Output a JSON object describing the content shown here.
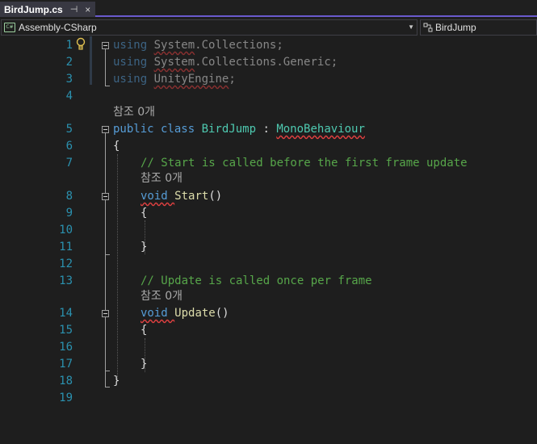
{
  "tab": {
    "title": "BirdJump.cs",
    "pin_glyph": "⊣",
    "close_glyph": "×"
  },
  "navbar": {
    "project": "Assembly-CSharp",
    "type": "BirdJump",
    "cs_badge": "C#"
  },
  "code_lens": {
    "refs": "참조 0개"
  },
  "lines": [
    {
      "n": "1",
      "text": "using System.Collections;"
    },
    {
      "n": "2",
      "text": "using System.Collections.Generic;"
    },
    {
      "n": "3",
      "text": "using UnityEngine;"
    },
    {
      "n": "4",
      "text": ""
    },
    {
      "n": "5",
      "kw": "public class ",
      "name": "BirdJump",
      "sep": " : ",
      "base": "MonoBehaviour"
    },
    {
      "n": "6",
      "text": "{"
    },
    {
      "n": "7",
      "comment": "// Start is called before the first frame update"
    },
    {
      "n": "8",
      "kw": "void ",
      "name": "Start",
      "tail": "()"
    },
    {
      "n": "9",
      "text": "{"
    },
    {
      "n": "10",
      "text": ""
    },
    {
      "n": "11",
      "text": "}"
    },
    {
      "n": "12",
      "text": ""
    },
    {
      "n": "13",
      "comment": "// Update is called once per frame"
    },
    {
      "n": "14",
      "kw": "void ",
      "name": "Update",
      "tail": "()"
    },
    {
      "n": "15",
      "text": "{"
    },
    {
      "n": "16",
      "text": ""
    },
    {
      "n": "17",
      "text": "}"
    },
    {
      "n": "18",
      "text": "}"
    },
    {
      "n": "19",
      "text": ""
    }
  ],
  "tokens": {
    "using": "using",
    "system": "System",
    "collections": "Collections",
    "generic": "Generic",
    "unity_engine": "UnityEngine",
    "dot": ".",
    "semi": ";"
  },
  "colors": {
    "keyword": "#569cd6",
    "class": "#4ec9b0",
    "comment": "#57a64a",
    "method": "#dcdcaa",
    "line_number": "#2b91af"
  },
  "icons": {
    "lightbulb": "lightbulb-icon",
    "fold": "collapse-icon"
  }
}
